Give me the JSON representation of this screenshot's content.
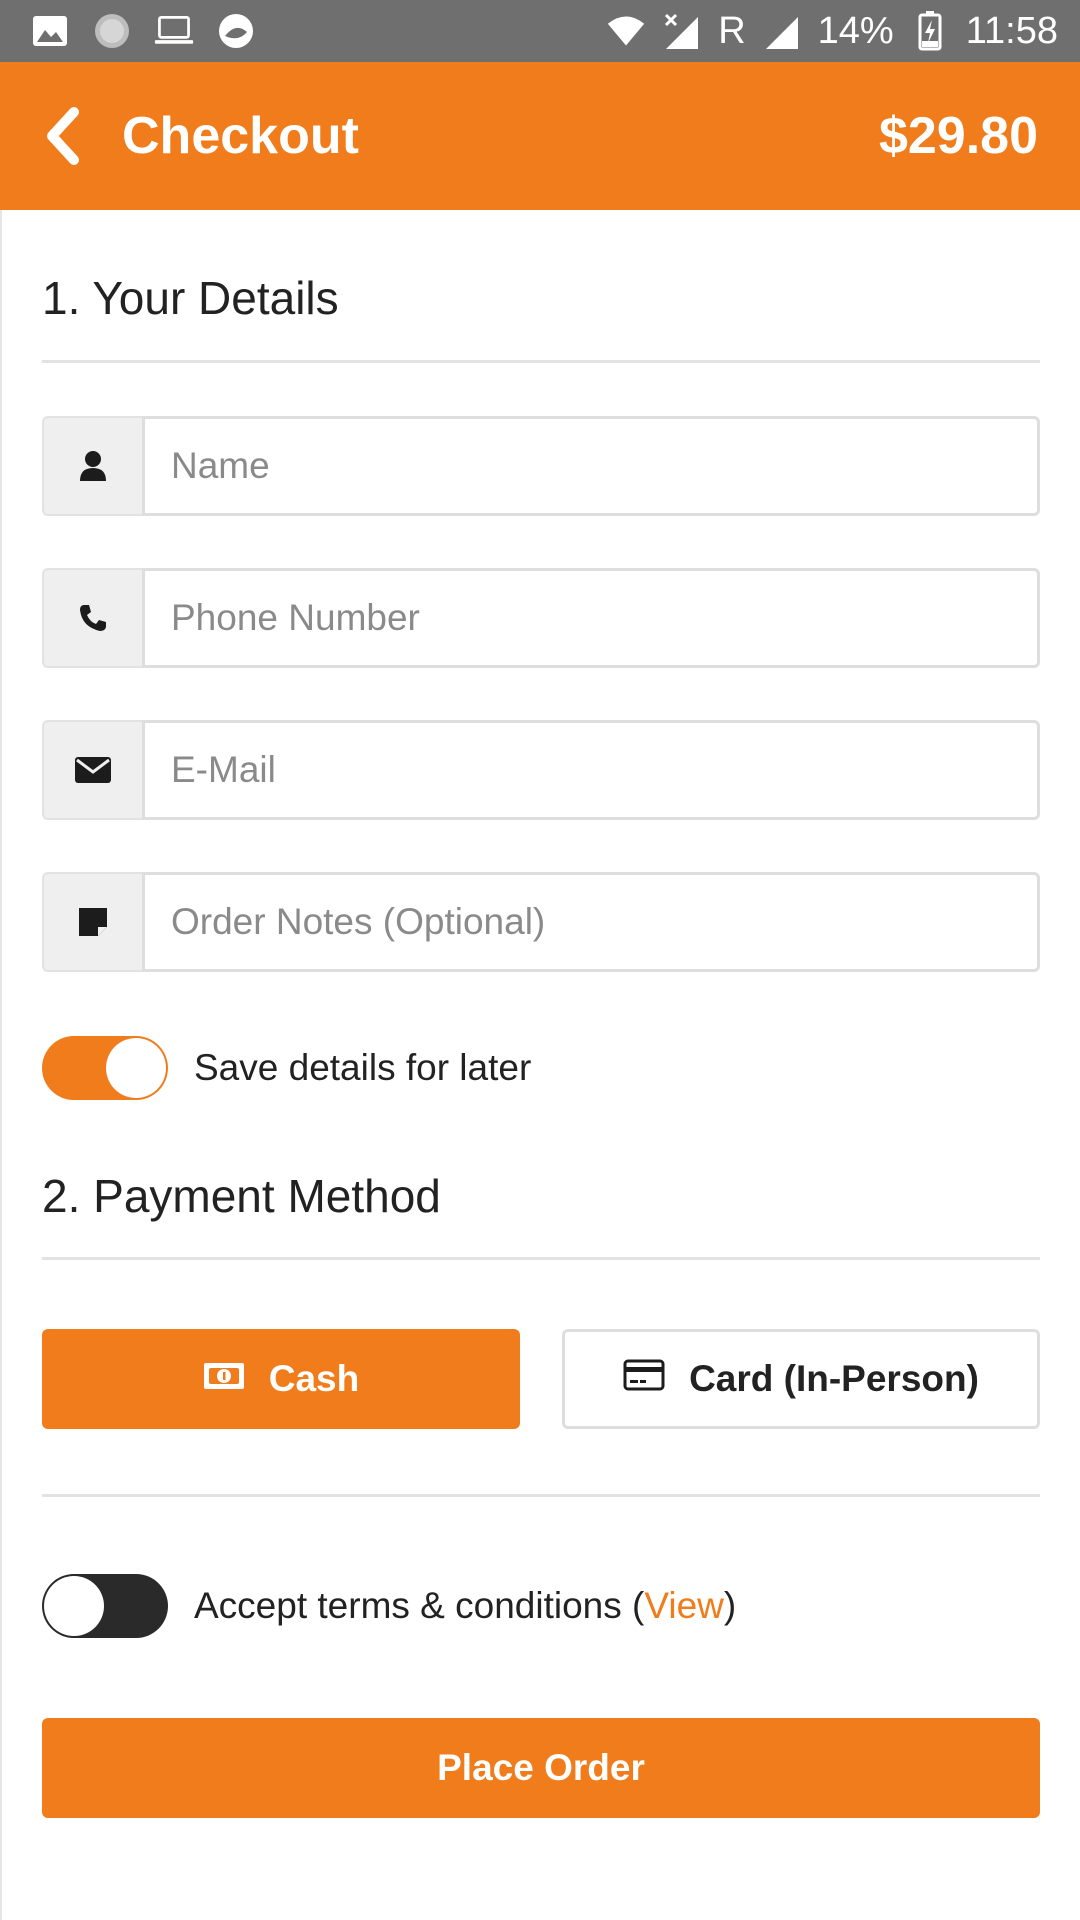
{
  "status_bar": {
    "battery": "14%",
    "time": "11:58",
    "roaming_label": "R",
    "left_icons": [
      "image-icon",
      "loading-icon",
      "laptop-icon",
      "app-icon"
    ],
    "right_icons": [
      "wifi-icon",
      "no-signal-icon",
      "signal-icon",
      "battery-charging-icon"
    ]
  },
  "app_bar": {
    "title": "Checkout",
    "total": "$29.80",
    "back_icon": "chevron-left-icon"
  },
  "details_section": {
    "title": "1. Your Details",
    "fields": [
      {
        "icon": "user-icon",
        "placeholder": "Name",
        "value": ""
      },
      {
        "icon": "phone-icon",
        "placeholder": "Phone Number",
        "value": ""
      },
      {
        "icon": "envelope-icon",
        "placeholder": "E-Mail",
        "value": ""
      },
      {
        "icon": "note-icon",
        "placeholder": "Order Notes (Optional)",
        "value": ""
      }
    ],
    "save_toggle": {
      "label": "Save details for later",
      "on": true
    }
  },
  "payment_section": {
    "title": "2. Payment Method",
    "options": [
      {
        "label": "Cash",
        "icon": "cash-icon",
        "selected": true
      },
      {
        "label": "Card (In-Person)",
        "icon": "credit-card-icon",
        "selected": false
      }
    ]
  },
  "terms": {
    "label_before": "Accept terms & conditions (",
    "link_text": "View",
    "label_after": ")",
    "on": false
  },
  "place_order_label": "Place Order",
  "colors": {
    "accent": "#f07c1b",
    "status_bar": "#6f6f6f",
    "toggle_off": "#2a2a2a",
    "text": "#222222",
    "placeholder": "#8a8a8a"
  }
}
